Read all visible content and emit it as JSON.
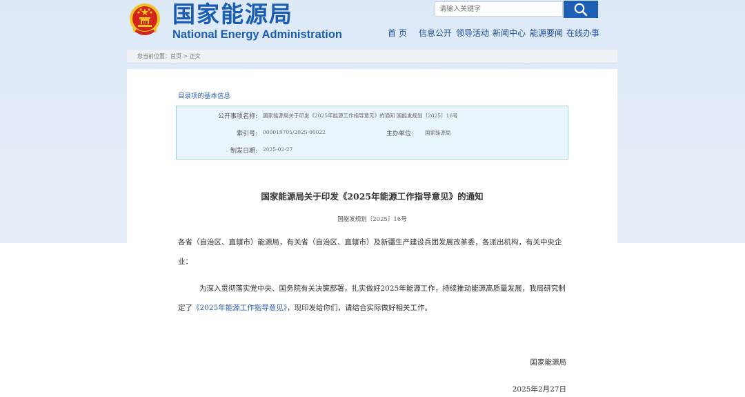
{
  "header": {
    "title_cn": "国家能源局",
    "title_en": "National Energy Administration",
    "search_placeholder": "请输入关键字"
  },
  "nav": {
    "items": [
      "首 页",
      "信息公开",
      "领导活动",
      "新闻中心",
      "能源要闻",
      "在线办事"
    ]
  },
  "breadcrumb": {
    "prefix": "您当前位置：",
    "home": "首页",
    "separator": " > ",
    "current": "正文"
  },
  "info": {
    "heading": "目录项的基本信息",
    "name_label": "公开事项名称:",
    "name_value": "国家能源局关于印发《2025年能源工作指导意见》的通知 国能发规划〔2025〕16号",
    "index_label": "索引号:",
    "index_value": "000019705/2025-00022",
    "org_label": "主办单位:",
    "org_value": "国家能源局",
    "date_label": "制发日期:",
    "date_value": "2025-02-27"
  },
  "document": {
    "title": "国家能源局关于印发《2025年能源工作指导意见》的通知",
    "number": "国能发规划〔2025〕16号",
    "para1": "各省（自治区、直辖市）能源局，有关省（自治区、直辖市）及新疆生产建设兵团发展改革委，各派出机构，有关中央企业：",
    "para2_before": "为深入贯彻落实党中央、国务院有关决策部署，扎实做好2025年能源工作，持续推动能源高质量发展，我局研究制定了",
    "para2_link": "《2025年能源工作指导意见》",
    "para2_after": "，现印发给你们，请结合实际做好相关工作。",
    "sign_org": "国家能源局",
    "sign_date": "2025年2月27日"
  },
  "colors": {
    "brand_blue": "#1a5db3",
    "nav_blue": "#1c4f98",
    "info_bg": "#e9f6fb",
    "info_border": "#97d1e6",
    "emblem_red": "#d4251d",
    "emblem_gold": "#f3c423"
  },
  "icons": {
    "search": "search-icon",
    "emblem": "national-emblem-icon"
  }
}
